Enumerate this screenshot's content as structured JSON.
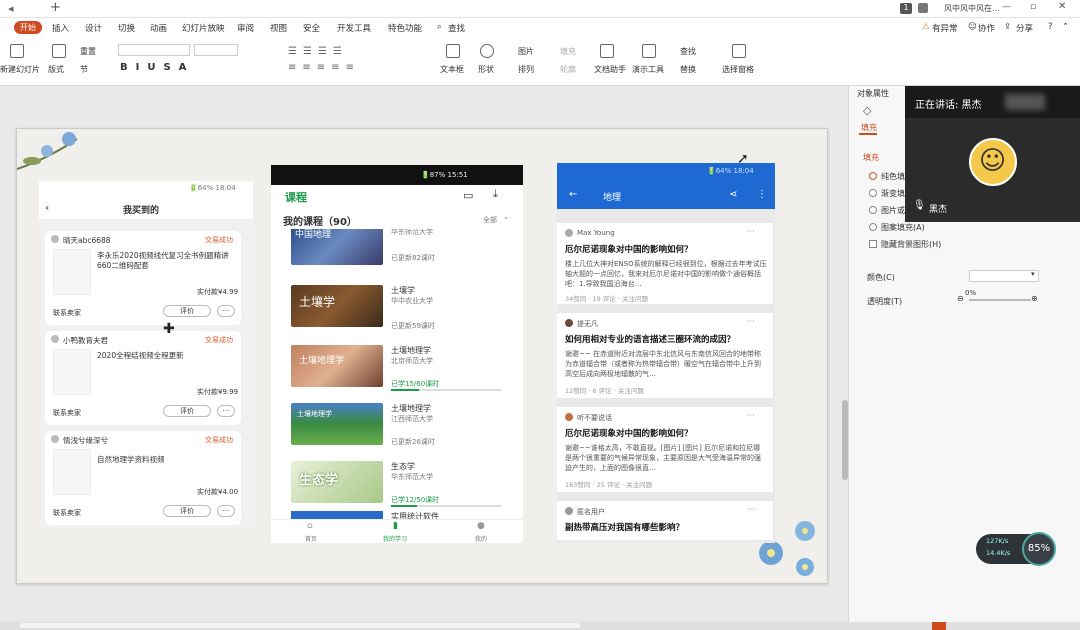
{
  "titlebar": {
    "badge": "1",
    "doc_name": "风中风中风在…"
  },
  "menu": {
    "start": "开始",
    "items": [
      "插入",
      "设计",
      "切换",
      "动画",
      "幻灯片放映",
      "审阅",
      "视图",
      "安全",
      "开发工具",
      "特色功能",
      "查找"
    ],
    "unsaved": "有异常",
    "collab": "协作",
    "share": "分享"
  },
  "ribbon": {
    "new_slide": "新建幻灯片",
    "layout": "版式",
    "reset": "重置",
    "section": "节",
    "textbox": "文本框",
    "shape": "形状",
    "arrange": "排列",
    "picture": "图片",
    "fill": "填充",
    "outline": "轮廓",
    "doc_helper": "文档助手",
    "presenter_tools": "演示工具",
    "find": "查找",
    "replace": "替换",
    "select_pane": "选择窗格"
  },
  "phone1": {
    "status": "🔋64% 18:04",
    "title": "我买到的",
    "orders": [
      {
        "shop": "晴天abc6688",
        "status": "交易成功",
        "desc": "李永乐2020视频线代复习全书例题精讲660二维码配套",
        "price": "实付款¥4.99",
        "contact": "联系卖家",
        "review": "评价",
        "more": "···"
      },
      {
        "shop": "小鸭教育夫君",
        "status": "交易成功",
        "desc": "2020全程结视频全程更新",
        "price": "实付款¥9.99",
        "contact": "联系卖家",
        "review": "评价",
        "more": "···"
      },
      {
        "shop": "情浅兮缘深兮",
        "status": "交易成功",
        "desc": "自然地理学资料视频",
        "price": "实付款¥4.00",
        "contact": "联系卖家",
        "review": "评价",
        "more": "···"
      }
    ]
  },
  "phone2": {
    "status": "🔋87% 15:51",
    "app_title": "课程",
    "section": "我的课程（90）",
    "filter": "全部",
    "courses": [
      {
        "img_text": "中国地理",
        "title": "",
        "school": "华东师范大学",
        "progress_text": "已更新82课时",
        "progress": 0
      },
      {
        "img_text": "土壤学",
        "title": "土壤学",
        "school": "华中农业大学",
        "progress_text": "已更新59课时",
        "progress": 0
      },
      {
        "img_text": "土壤地理学",
        "title": "土壤地理学",
        "school": "北京师范大学",
        "progress_text": "已学15/60课时",
        "progress": 0.25
      },
      {
        "img_text": "土壤地理学",
        "title": "土壤地理学",
        "school": "江西师范大学",
        "progress_text": "已更新26课时",
        "progress": 0
      },
      {
        "img_text": "生态学",
        "title": "生态学",
        "school": "华东师范大学",
        "progress_text": "已学12/50课时",
        "progress": 0.24
      },
      {
        "img_text": "",
        "title": "实用统计软件",
        "school": "",
        "progress_text": "",
        "progress": 0
      }
    ],
    "tabs": [
      "首页",
      "我的学习",
      "我的"
    ]
  },
  "phone3": {
    "status": "🔋64% 18:04",
    "title": "地理",
    "questions": [
      {
        "user": "Max Young",
        "title": "厄尔尼诺现象对中国的影响如何？",
        "body": "楼上几位大神对ENSO系统的解释已经很到位，根据过去年考试压轴大题的一点回忆，我来对厄尔尼诺对中国的影响做个通俗概括吧：1.导致我国沿海台…",
        "meta": "34赞同 · 19 评论 · 关注问题"
      },
      {
        "user": "提无凡",
        "title": "如何用相对专业的语言描述三圈环流的成因？",
        "body": "谢邀~~ 在赤道附近对流层中东北信风与东南信风回合的地带称为赤道辐合带（或者称为热带辐合带）暖空气在辐合带中上升到高空后成向两极地辐散的气…",
        "meta": "12赞同 · 6 评论 · 关注问题"
      },
      {
        "user": "听不要说话",
        "title": "厄尔尼诺现象对中国的影响如何？",
        "body": "谢邀~~谁格太高，不敢直视。[图片] [图片] 厄尔尼诺和拉尼娜是两个很重要的气候异常现象，主要原因是大气受海温异常的强迫产生的，上面的图像很直…",
        "meta": "163赞同 · 25 评论 · 关注问题"
      },
      {
        "user": "匿名用户",
        "title": "副热带高压对我国有哪些影响？",
        "body": "",
        "meta": ""
      }
    ]
  },
  "panel": {
    "title": "对象属性",
    "fill_tab": "填充",
    "fill_header": "填充",
    "options": [
      "纯色填充",
      "渐变填充",
      "图片或纹理填充",
      "图案填充(A)",
      "隐藏背景图形(H)"
    ],
    "color_label": "颜色(C)",
    "transparency_label": "透明度(T)",
    "transparency_value": "0%"
  },
  "video": {
    "speaking": "正在讲话: 黑杰",
    "name": "黑杰"
  },
  "net": {
    "up": "127K/s",
    "down": "14.4K/s",
    "cpu": "85%"
  }
}
